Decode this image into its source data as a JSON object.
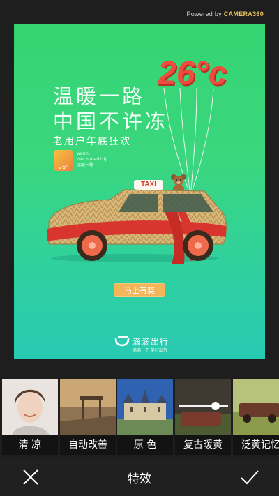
{
  "header": {
    "powered_by": "Powered by",
    "brand": "CAMERA360"
  },
  "poster": {
    "title": "温暖一路",
    "subtitle": "中国不许冻",
    "tagline": "老用户年底狂欢",
    "temperature": "26°c",
    "mini_logo_text": "26°",
    "mini_caption_1": "warm",
    "mini_caption_2": "much road trip",
    "mini_caption_3": "温暖一路",
    "taxi_sign": "TAXI",
    "cta": "马上有奖",
    "brand_name": "滴滴出行",
    "brand_slogan": "滴滴一下 美好出行"
  },
  "filters": [
    {
      "label": "清 凉",
      "thumb": "portrait-woman"
    },
    {
      "label": "自动改善",
      "thumb": "pier-sunset"
    },
    {
      "label": "原 色",
      "thumb": "castle"
    },
    {
      "label": "复古暖黄",
      "thumb": "slider-vintage"
    },
    {
      "label": "泛黄记忆",
      "thumb": "old-car-field"
    }
  ],
  "footer": {
    "title": "特效"
  },
  "colors": {
    "poster_green": "#34d471",
    "accent_red": "#ee4c3e",
    "cta_orange": "#f2b559",
    "bar_dark": "#202020"
  }
}
